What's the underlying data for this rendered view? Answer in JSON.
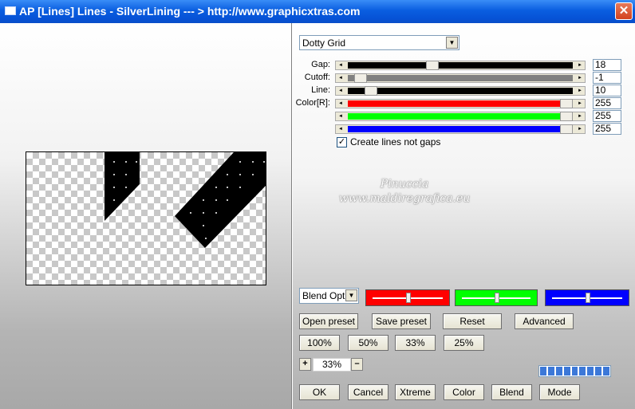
{
  "window": {
    "title": "AP [Lines]  Lines - SilverLining     --- > http://www.graphicxtras.com",
    "close_glyph": "✕"
  },
  "preset_select": {
    "value": "Dotty Grid"
  },
  "sliders": [
    {
      "label": "Gap:",
      "value": "18",
      "fill_color": "#000000",
      "level": 0.37
    },
    {
      "label": "Cutoff:",
      "value": "-1",
      "fill_color": "#808080",
      "level": 0.03
    },
    {
      "label": "Line:",
      "value": "10",
      "fill_color": "#000000",
      "level": 0.08
    },
    {
      "label": "Color[R]:",
      "value": "255",
      "fill_color": "#ff0000",
      "level": 1.0
    },
    {
      "label": "",
      "value": "255",
      "fill_color": "#00ff00",
      "level": 1.0
    },
    {
      "label": "",
      "value": "255",
      "fill_color": "#0000ff",
      "level": 1.0
    }
  ],
  "checkbox": {
    "label": "Create lines not gaps",
    "checked": true,
    "glyph": "✓"
  },
  "watermark": {
    "line1": "Pinuccia",
    "line2": "www.maldiregrafica.eu"
  },
  "blend_select": {
    "value": "Blend Optio"
  },
  "color_boxes": [
    {
      "name": "red",
      "color": "#ff0000",
      "level": 0.5
    },
    {
      "name": "green",
      "color": "#00ff00",
      "level": 0.5
    },
    {
      "name": "blue",
      "color": "#0000ff",
      "level": 0.5
    }
  ],
  "buttons_row1": [
    "Open preset",
    "Save preset",
    "Reset",
    "Advanced"
  ],
  "zoom_buttons": [
    "100%",
    "50%",
    "33%",
    "25%"
  ],
  "zoom": {
    "plus": "+",
    "value": "33%",
    "minus": "–"
  },
  "progress": {
    "segments": 9,
    "level": 1.0
  },
  "bottom_buttons": [
    "OK",
    "Cancel",
    "Xtreme",
    "Color",
    "Blend",
    "Mode"
  ],
  "icons": {
    "dropdown": "▼",
    "arrow_left": "◄",
    "arrow_right": "►"
  }
}
